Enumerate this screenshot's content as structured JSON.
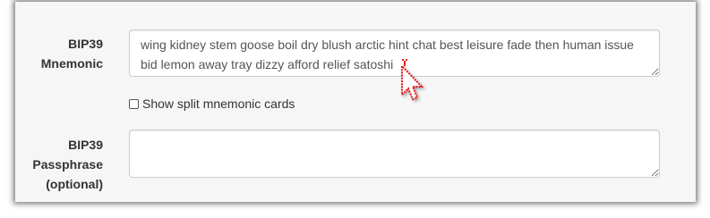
{
  "mnemonic": {
    "label_line1": "BIP39",
    "label_line2": "Mnemonic",
    "value": "wing kidney stem goose boil dry blush arctic hint chat best leisure fade then human issue bid lemon away tray dizzy afford relief satoshi"
  },
  "split_cards": {
    "label": "Show split mnemonic cards",
    "checked": false
  },
  "passphrase": {
    "label_line1": "BIP39",
    "label_line2": "Passphrase",
    "label_line3": "(optional)",
    "value": ""
  },
  "icons": {
    "cursor": "mouse-pointer-icon"
  },
  "colors": {
    "cursor": "#e8141b",
    "panel_background": "#f6f6f6"
  }
}
